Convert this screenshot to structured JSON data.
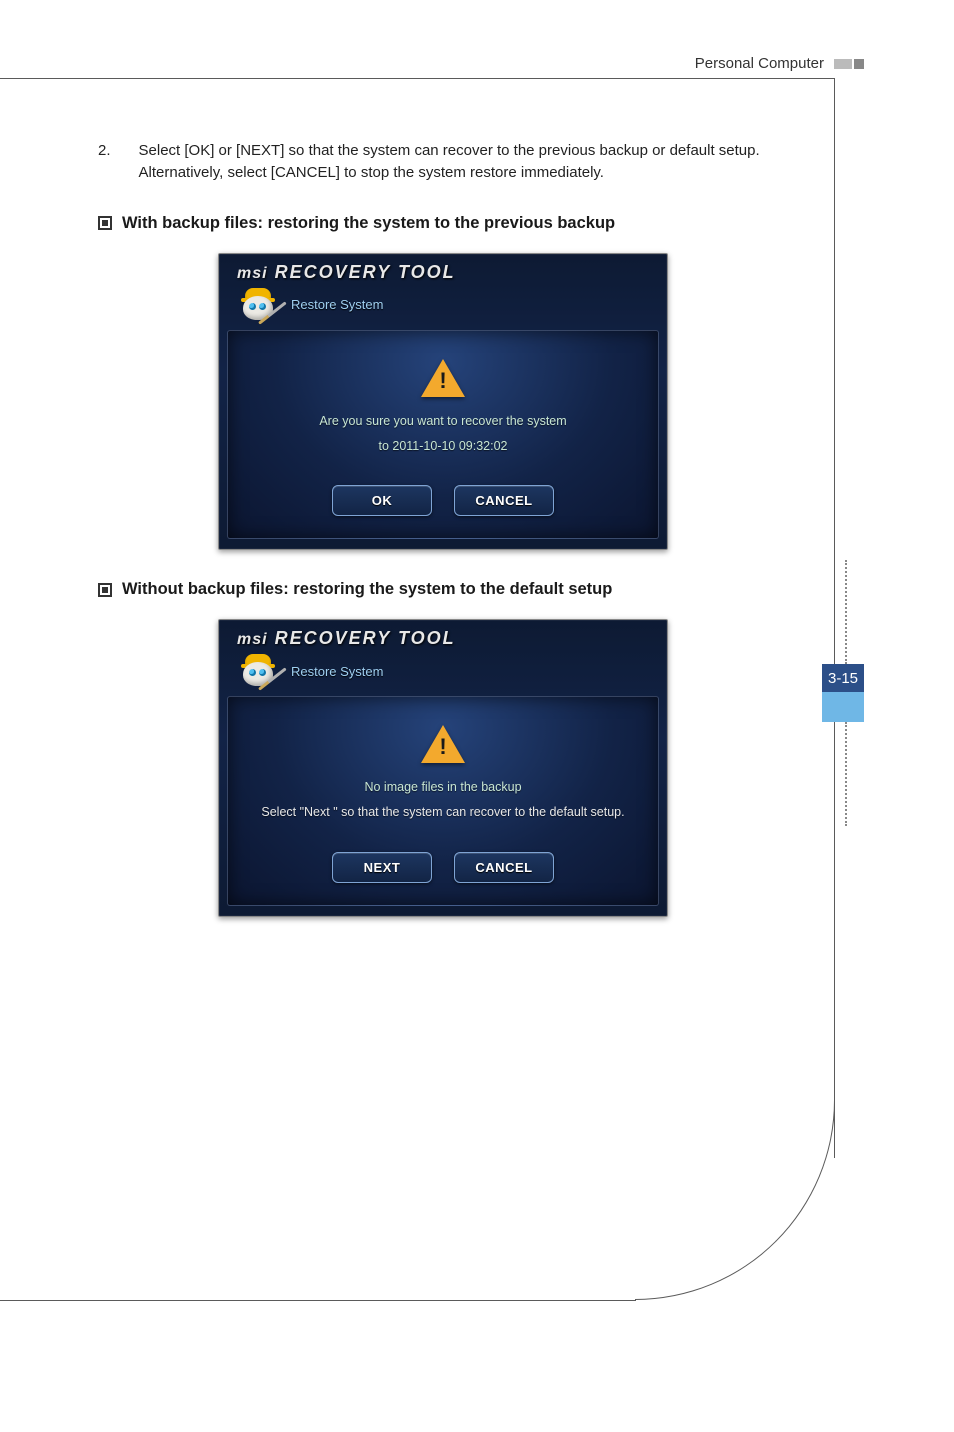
{
  "header": {
    "title": "Personal Computer"
  },
  "page": {
    "number": "3-15"
  },
  "instruction": {
    "number": "2.",
    "text": "Select [OK] or [NEXT] so that the system can recover to the previous backup or default setup. Alternatively, select [CANCEL] to stop the system restore immediately."
  },
  "sections": [
    {
      "heading": "With backup files: restoring the system to the previous backup"
    },
    {
      "heading": "Without backup files: restoring the system to the default setup"
    }
  ],
  "dialog1": {
    "brand": "msi",
    "title": "RECOVERY TOOL",
    "subtitle": "Restore System",
    "line1": "Are you sure you want to recover the system",
    "line2": "to 2011-10-10 09:32:02",
    "ok": "OK",
    "cancel": "CANCEL"
  },
  "dialog2": {
    "brand": "msi",
    "title": "RECOVERY TOOL",
    "subtitle": "Restore System",
    "line1": "No image files in the backup",
    "line2": "Select \"Next \" so that the system can recover to the default setup.",
    "next": "NEXT",
    "cancel": "CANCEL"
  }
}
